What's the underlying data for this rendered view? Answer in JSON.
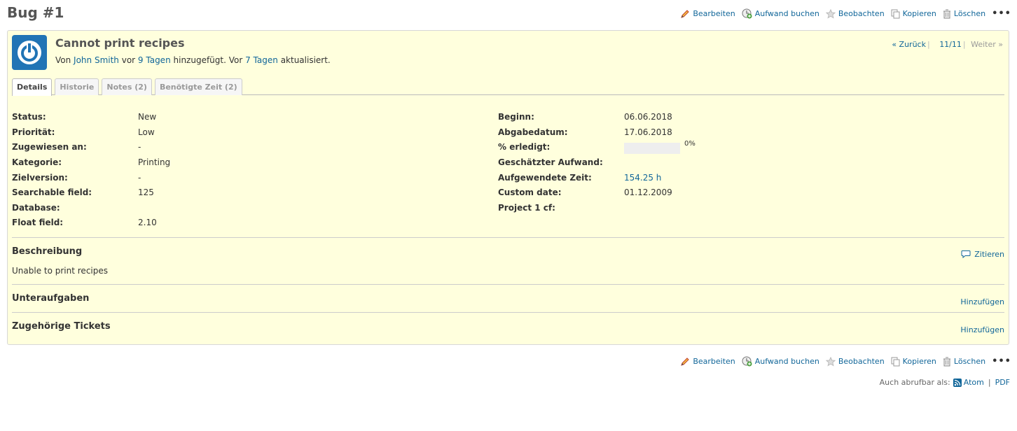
{
  "page": {
    "title": "Bug #1"
  },
  "actions": {
    "edit": "Bearbeiten",
    "log_time": "Aufwand buchen",
    "watch": "Beobachten",
    "copy": "Kopieren",
    "delete": "Löschen",
    "more": "•••"
  },
  "issue": {
    "subject": "Cannot print recipes",
    "author_prefix": "Von ",
    "author": "John Smith",
    "created_pre": " vor ",
    "created_ago": "9 Tagen",
    "created_post": " hinzugefügt. Vor ",
    "updated_ago": "7 Tagen",
    "updated_post": " aktualisiert."
  },
  "navigation": {
    "previous": "« Zurück",
    "position": "11/11",
    "next": "Weiter »",
    "separator": "|"
  },
  "tabs": [
    {
      "label": "Details"
    },
    {
      "label": "Historie"
    },
    {
      "label": "Notes (2)"
    },
    {
      "label": "Benötigte Zeit (2)"
    }
  ],
  "attributes_left": [
    {
      "label": "Status:",
      "value": "New"
    },
    {
      "label": "Priorität:",
      "value": "Low"
    },
    {
      "label": "Zugewiesen an:",
      "value": "-"
    },
    {
      "label": "Kategorie:",
      "value": "Printing"
    },
    {
      "label": "Zielversion:",
      "value": "-"
    },
    {
      "label": "Searchable field:",
      "value": "125"
    },
    {
      "label": "Database:",
      "value": ""
    },
    {
      "label": "Float field:",
      "value": "2.10"
    }
  ],
  "attributes_right": [
    {
      "label": "Beginn:",
      "value": "06.06.2018"
    },
    {
      "label": "Abgabedatum:",
      "value": "17.06.2018"
    },
    {
      "label": "% erledigt:",
      "value": "0%",
      "progress": 0
    },
    {
      "label": "Geschätzter Aufwand:",
      "value": ""
    },
    {
      "label": "Aufgewendete Zeit:",
      "value": "154.25 h"
    },
    {
      "label": "Custom date:",
      "value": "01.12.2009"
    },
    {
      "label": "Project 1 cf:",
      "value": ""
    }
  ],
  "description": {
    "title": "Beschreibung",
    "quote": "Zitieren",
    "text": "Unable to print recipes"
  },
  "subtasks": {
    "title": "Unteraufgaben",
    "add": "Hinzufügen"
  },
  "relations": {
    "title": "Zugehörige Tickets",
    "add": "Hinzufügen"
  },
  "other_formats": {
    "label": "Auch abrufbar als:",
    "atom": "Atom",
    "separator": "|",
    "pdf": "PDF"
  },
  "colors": {
    "link": "#116699",
    "issue_bg": "#ffffdd",
    "avatar": "#2174b5"
  }
}
